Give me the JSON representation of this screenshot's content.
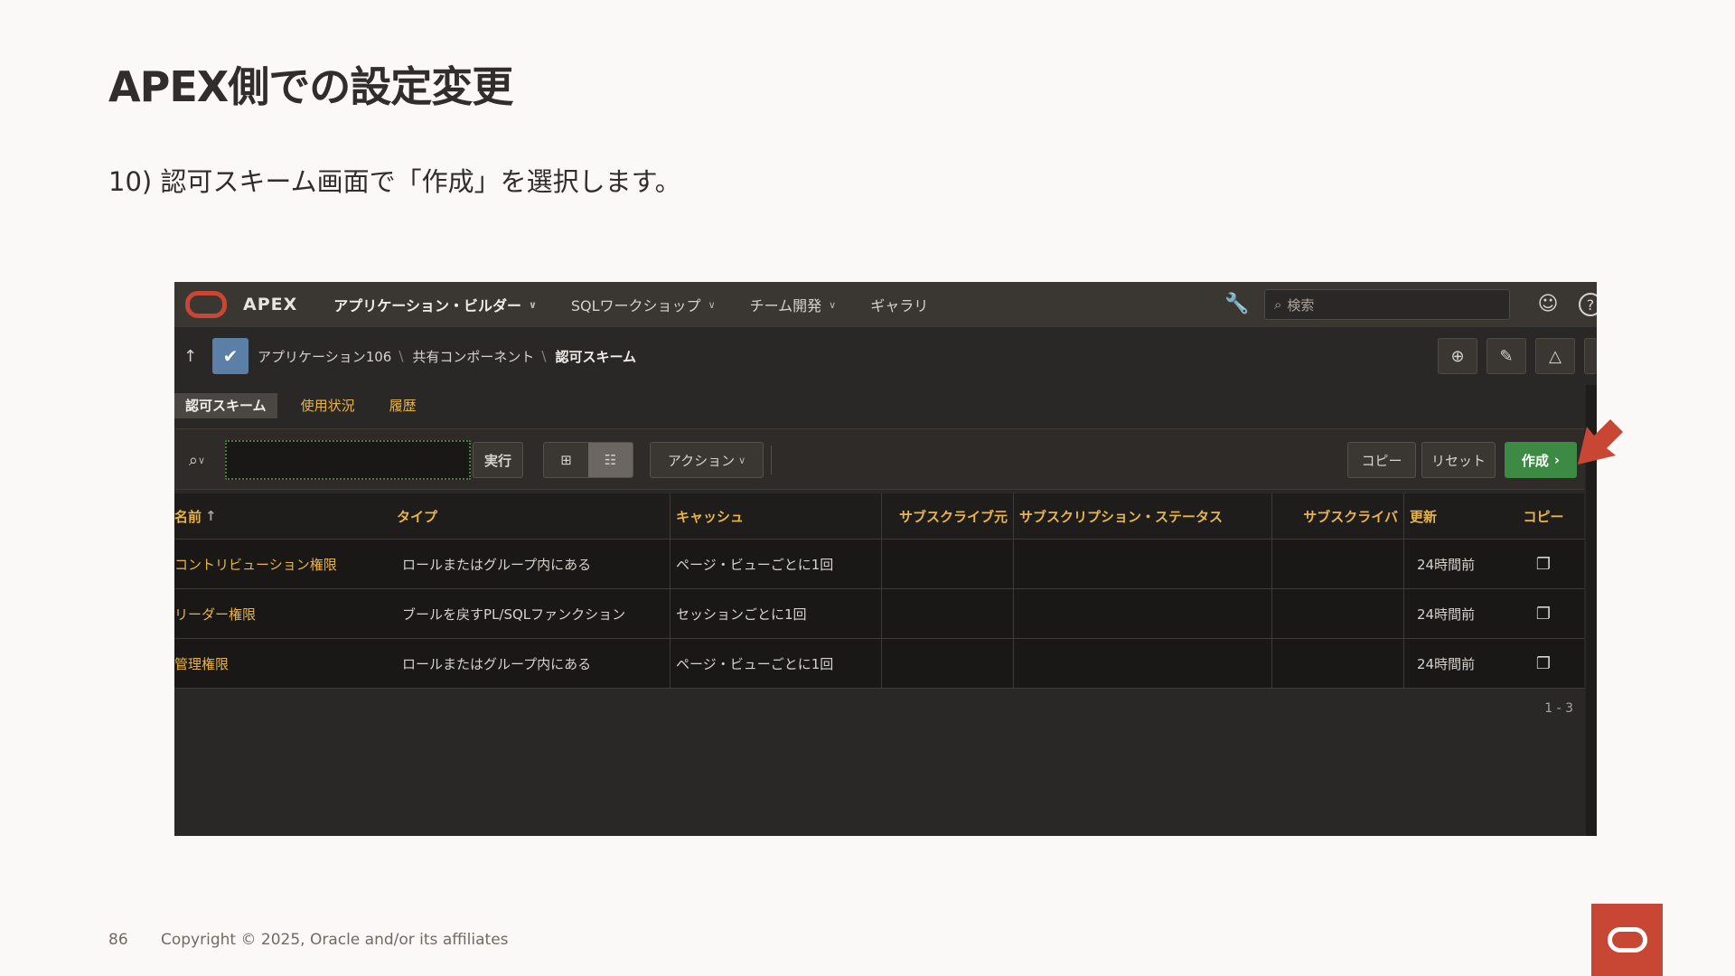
{
  "slide": {
    "title": "APEX側での設定変更",
    "step": "10) 認可スキーム画面で「作成」を選択します。",
    "page_number": "86",
    "copyright": "Copyright © 2025, Oracle and/or its affiliates"
  },
  "colors": {
    "oracle_red": "#c74634",
    "create_green": "#3c8a43",
    "link_gold": "#e8b44a"
  },
  "topbar": {
    "brand": "APEX",
    "nav": [
      {
        "label": "アプリケーション・ビルダー"
      },
      {
        "label": "SQLワークショップ"
      },
      {
        "label": "チーム開発"
      },
      {
        "label": "ギャラリ"
      }
    ],
    "search_placeholder": "検索"
  },
  "breadcrumb": {
    "items": [
      "アプリケーション106",
      "共有コンポーネント",
      "認可スキーム"
    ]
  },
  "tabs": [
    "認可スキーム",
    "使用状況",
    "履歴"
  ],
  "toolbar": {
    "go": "実行",
    "actions": "アクション",
    "copy": "コピー",
    "reset": "リセット",
    "create": "作成"
  },
  "table": {
    "headers": [
      "名前",
      "タイプ",
      "キャッシュ",
      "サブスクライブ元",
      "サブスクリプション・ステータス",
      "サブスクライバ",
      "更新",
      "コピー"
    ],
    "rows": [
      {
        "name": "コントリビューション権限",
        "type": "ロールまたはグループ内にある",
        "cache": "ページ・ビューごとに1回",
        "updated": "24時間前"
      },
      {
        "name": "リーダー権限",
        "type": "ブールを戻すPL/SQLファンクション",
        "cache": "セッションごとに1回",
        "updated": "24時間前"
      },
      {
        "name": "管理権限",
        "type": "ロールまたはグループ内にある",
        "cache": "ページ・ビューごとに1回",
        "updated": "24時間前"
      }
    ],
    "pagination": "1 - 3"
  }
}
